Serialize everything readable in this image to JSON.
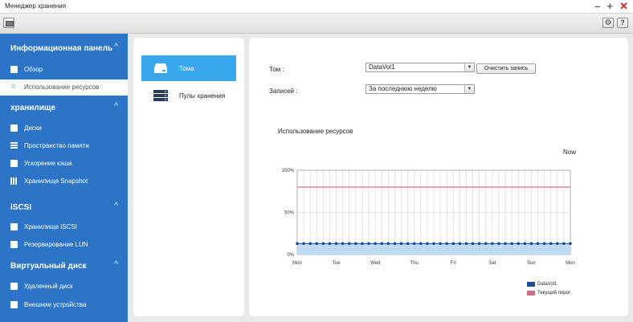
{
  "window": {
    "title": "Менеджер хранения"
  },
  "sidebar": {
    "sections": [
      {
        "label": "Информационная панель",
        "items": [
          {
            "label": "Обзор",
            "icon": "monitor-icon"
          },
          {
            "label": "Использование ресурсов",
            "icon": "chart-icon",
            "active": true
          }
        ]
      },
      {
        "label": "хранилище",
        "items": [
          {
            "label": "Диски",
            "icon": "disk-icon"
          },
          {
            "label": "Пространство памяти",
            "icon": "storage-pool-icon"
          },
          {
            "label": "Ускорение кэша",
            "icon": "cache-icon"
          },
          {
            "label": "Хранилище Snapshot",
            "icon": "snapshot-icon"
          }
        ]
      },
      {
        "label": "iSCSI",
        "items": [
          {
            "label": "Хранилище iSCSI",
            "icon": "iscsi-icon"
          },
          {
            "label": "Резервирование LUN",
            "icon": "lun-backup-icon"
          }
        ]
      },
      {
        "label": "Виртуальный диск",
        "items": [
          {
            "label": "Удаленный диск",
            "icon": "remote-disk-icon"
          },
          {
            "label": "Внешние устройства",
            "icon": "external-device-icon"
          }
        ]
      }
    ]
  },
  "volumes_panel": {
    "items": [
      {
        "label": "Тома",
        "active": true
      },
      {
        "label": "Пулы хранения",
        "active": false
      }
    ]
  },
  "form": {
    "volume_label": "Том :",
    "volume_value": "DataVol1",
    "clear_button": "Очистить запись",
    "records_label": "Записей :",
    "records_value": "За последнюю неделю"
  },
  "chart_title": "Использование ресурсов",
  "now_label": "Now",
  "chart_data": {
    "type": "line",
    "x": [
      "Mon",
      "Tue",
      "Wed",
      "Thu",
      "Fri",
      "Sat",
      "Sun",
      "Mon"
    ],
    "yticks": [
      "100%",
      "50%",
      "0%"
    ],
    "ylim": [
      0,
      100
    ],
    "grid": true,
    "legend": "bottom-right",
    "series": [
      {
        "name": "DataVol1",
        "color": "#1a4d9c",
        "fill": "#b8d7f4",
        "value": 13,
        "points": 43
      },
      {
        "name": "Текущий порог",
        "color": "#cc6f86",
        "value": 80
      }
    ]
  }
}
